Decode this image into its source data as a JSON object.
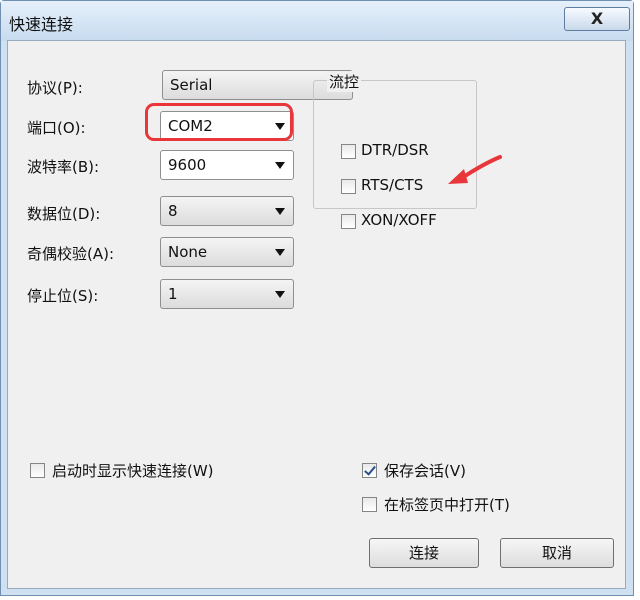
{
  "window": {
    "title": "快速连接",
    "close_symbol": "X"
  },
  "form": {
    "protocol": {
      "label": "协议(P):",
      "value": "Serial"
    },
    "port": {
      "label": "端口(O):",
      "value": "COM2"
    },
    "baud": {
      "label": "波特率(B):",
      "value": "9600"
    },
    "data_bits": {
      "label": "数据位(D):",
      "value": "8"
    },
    "parity": {
      "label": "奇偶校验(A):",
      "value": "None"
    },
    "stop_bits": {
      "label": "停止位(S):",
      "value": "1"
    }
  },
  "flow_control": {
    "title": "流控",
    "options": [
      {
        "label": "DTR/DSR",
        "checked": false
      },
      {
        "label": "RTS/CTS",
        "checked": false
      },
      {
        "label": "XON/XOFF",
        "checked": false
      }
    ]
  },
  "options": {
    "show_on_startup": {
      "label": "启动时显示快速连接(W)",
      "checked": false
    },
    "save_session": {
      "label": "保存会话(V)",
      "checked": true
    },
    "open_in_tab": {
      "label": "在标签页中打开(T)",
      "checked": false
    }
  },
  "buttons": {
    "connect": "连接",
    "cancel": "取消"
  },
  "colors": {
    "highlight": "#e8363a",
    "titlebar": "#c7dbef"
  }
}
